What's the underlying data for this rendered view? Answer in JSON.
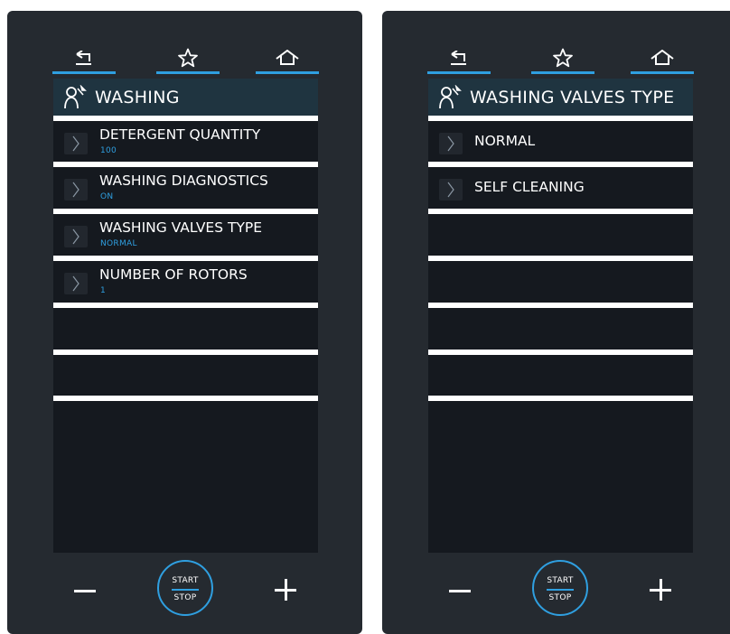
{
  "accent_color": "#2f9fe0",
  "left_panel": {
    "title": "WASHING",
    "items": [
      {
        "label": "DETERGENT QUANTITY",
        "value": "100"
      },
      {
        "label": "WASHING DIAGNOSTICS",
        "value": "ON"
      },
      {
        "label": "WASHING VALVES TYPE",
        "value": "NORMAL"
      },
      {
        "label": "NUMBER OF ROTORS",
        "value": "1"
      }
    ]
  },
  "right_panel": {
    "title": "WASHING VALVES TYPE",
    "options": [
      {
        "label": "NORMAL"
      },
      {
        "label": "SELF CLEANING"
      }
    ]
  },
  "controls": {
    "start_label": "START",
    "stop_label": "STOP"
  },
  "icons": {
    "back": "back-arrow-icon",
    "favorites": "star-icon",
    "home": "home-icon",
    "menu": "service-wrench-icon",
    "chevron": "chevron-right-icon",
    "minus": "minus-icon",
    "plus": "plus-icon"
  }
}
